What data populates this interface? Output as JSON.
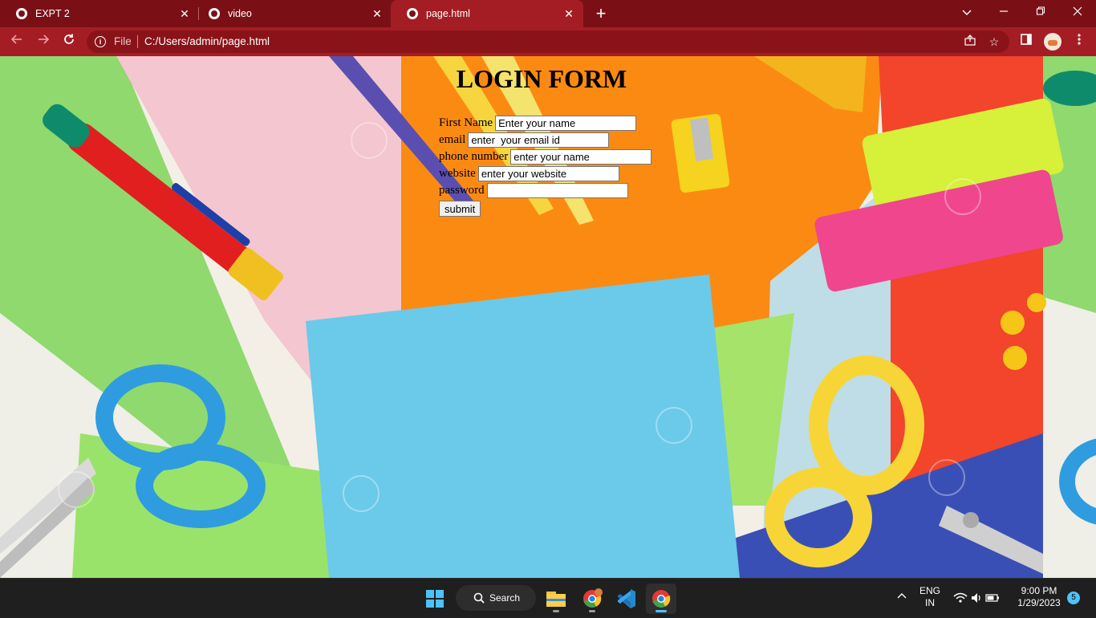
{
  "browser": {
    "tabs": [
      {
        "title": "EXPT 2",
        "active": false
      },
      {
        "title": "video",
        "active": false
      },
      {
        "title": "page.html",
        "active": true
      }
    ],
    "omnibox": {
      "scheme_label": "File",
      "url": "C:/Users/admin/page.html"
    }
  },
  "page": {
    "heading": "LOGIN FORM",
    "fields": [
      {
        "label": "First Name",
        "placeholder": "Enter your name"
      },
      {
        "label": "email",
        "placeholder": "enter  your email id"
      },
      {
        "label": "phone number",
        "placeholder": "enter your name"
      },
      {
        "label": "website",
        "placeholder": "enter your website"
      },
      {
        "label": "password",
        "placeholder": ""
      }
    ],
    "submit_label": "submit"
  },
  "taskbar": {
    "search_label": "Search",
    "language": "ENG",
    "region": "IN",
    "time": "9:00 PM",
    "date": "1/29/2023",
    "notification_count": "5"
  },
  "colors": {
    "tabstrip": "#7a1016",
    "toolbar": "#a51d24",
    "taskbar": "#1f1f1f",
    "accent": "#4cc2ff"
  }
}
